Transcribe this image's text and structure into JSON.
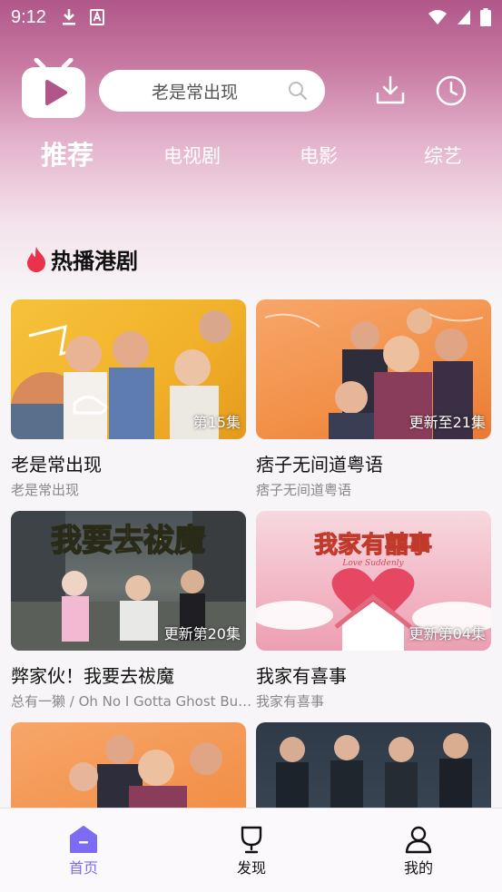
{
  "status_bar": {
    "time": "9:12",
    "left_icons": [
      "download-notification-icon",
      "font-app-icon"
    ],
    "right_icons": [
      "wifi-icon",
      "cellular-signal-icon",
      "battery-icon"
    ]
  },
  "header": {
    "logo": "tv-play-logo",
    "search": {
      "value": "老是常出现"
    },
    "actions": [
      "download-icon",
      "history-icon"
    ]
  },
  "tabs": [
    {
      "label": "推荐",
      "active": true
    },
    {
      "label": "电视剧",
      "active": false
    },
    {
      "label": "电影",
      "active": false
    },
    {
      "label": "综艺",
      "active": false
    }
  ],
  "section": {
    "title": "热播港剧",
    "icon": "fire-icon"
  },
  "cards": [
    {
      "title": "老是常出现",
      "subtitle": "老是常出现",
      "badge": "第15集"
    },
    {
      "title": "痞子无间道粤语",
      "subtitle": "痞子无间道粤语",
      "badge": "更新至21集"
    },
    {
      "title": "弊家伙！我要去祓魔",
      "subtitle": "总有一獭 / Oh No I Gotta Ghost Bu…",
      "badge": "更新第20集",
      "poster_text": "我要去祓魔"
    },
    {
      "title": "我家有喜事",
      "subtitle": "我家有喜事",
      "badge": "更新第04集",
      "poster_text": "我家有囍事",
      "poster_subtext": "Love Suddenly"
    },
    {
      "title": "",
      "subtitle": "",
      "badge": ""
    },
    {
      "title": "",
      "subtitle": "",
      "badge": ""
    }
  ],
  "bottom_nav": [
    {
      "label": "首页",
      "icon": "home-icon",
      "active": true
    },
    {
      "label": "发现",
      "icon": "trophy-icon",
      "active": false
    },
    {
      "label": "我的",
      "icon": "user-icon",
      "active": false
    }
  ],
  "colors": {
    "header_gradient_top": "#b0578a",
    "accent_purple": "#7c6cf4",
    "fire_red": "#e8334a"
  }
}
